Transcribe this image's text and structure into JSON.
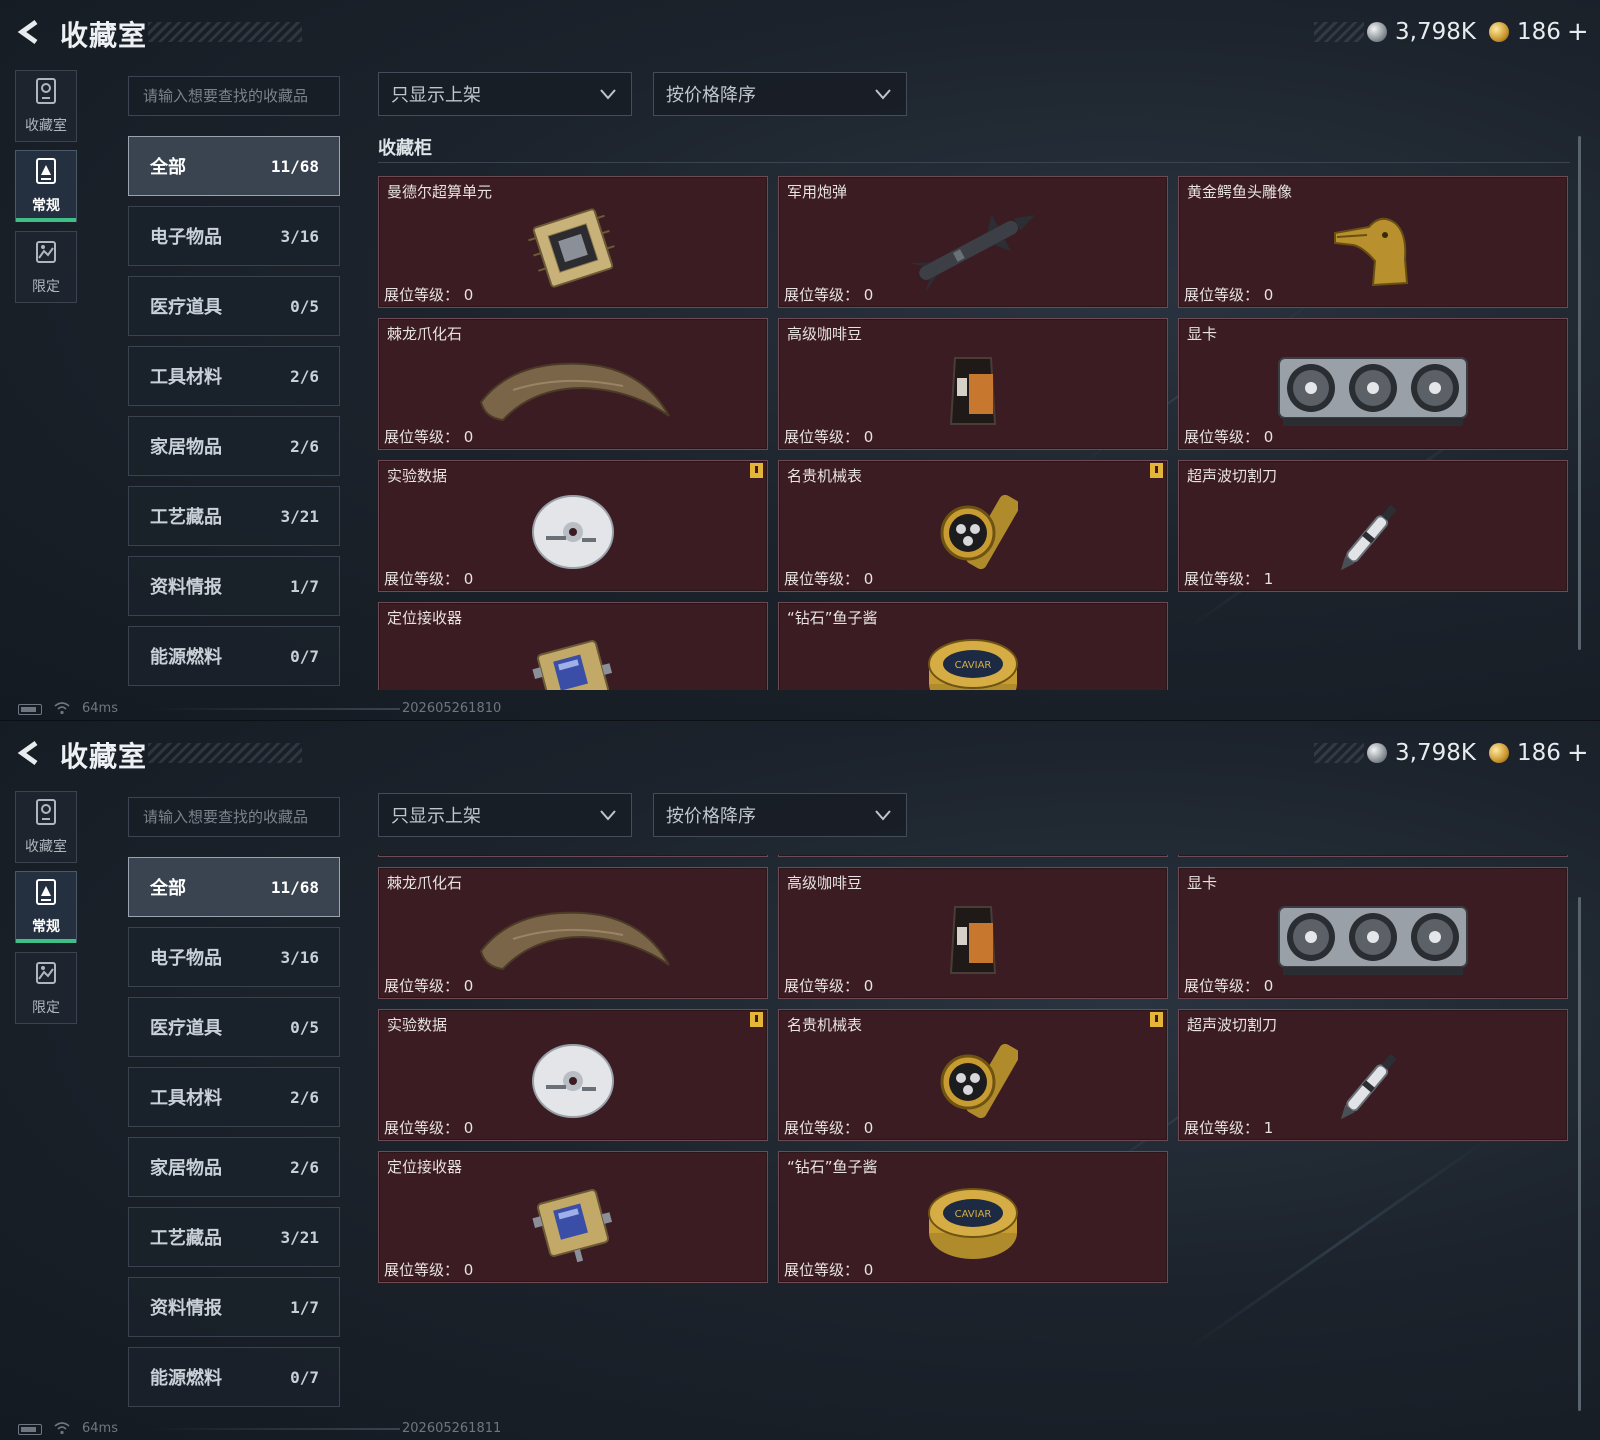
{
  "title": "收藏室",
  "currency": {
    "silver": "3,798K",
    "gold": "186",
    "add": "+"
  },
  "rail": [
    {
      "label": "收藏室",
      "icon": "trophy-icon",
      "active": false
    },
    {
      "label": "常规",
      "icon": "upload-icon",
      "active": true
    },
    {
      "label": "限定",
      "icon": "image-icon",
      "active": false
    }
  ],
  "search": {
    "placeholder": "请输入想要查找的收藏品",
    "value": ""
  },
  "filters": {
    "shelf": "只显示上架",
    "sort": "按价格降序"
  },
  "categories": [
    {
      "label": "全部",
      "count": "11/68"
    },
    {
      "label": "电子物品",
      "count": "3/16"
    },
    {
      "label": "医疗道具",
      "count": "0/5"
    },
    {
      "label": "工具材料",
      "count": "2/6"
    },
    {
      "label": "家居物品",
      "count": "2/6"
    },
    {
      "label": "工艺藏品",
      "count": "3/21"
    },
    {
      "label": "资料情报",
      "count": "1/7"
    },
    {
      "label": "能源燃料",
      "count": "0/7"
    }
  ],
  "section_title": "收藏柜",
  "level_label": "展位等级：",
  "items": [
    {
      "name": "曼德尔超算单元",
      "level": "0",
      "icon": "cpu-chip-icon",
      "alert": false
    },
    {
      "name": "军用炮弹",
      "level": "0",
      "icon": "missile-icon",
      "alert": false
    },
    {
      "name": "黄金鳄鱼头雕像",
      "level": "0",
      "icon": "gold-crocodile-statue-icon",
      "alert": false
    },
    {
      "name": "棘龙爪化石",
      "level": "0",
      "icon": "claw-fossil-icon",
      "alert": false
    },
    {
      "name": "高级咖啡豆",
      "level": "0",
      "icon": "coffee-bag-icon",
      "alert": false
    },
    {
      "name": "显卡",
      "level": "0",
      "icon": "graphics-card-icon",
      "alert": false
    },
    {
      "name": "实验数据",
      "level": "0",
      "icon": "disc-icon",
      "alert": true
    },
    {
      "name": "名贵机械表",
      "level": "0",
      "icon": "watch-icon",
      "alert": true
    },
    {
      "name": "超声波切割刀",
      "level": "1",
      "icon": "knife-icon",
      "alert": false
    },
    {
      "name": "定位接收器",
      "level": "0",
      "icon": "receiver-icon",
      "alert": false
    },
    {
      "name": "“钻石”鱼子酱",
      "level": "0",
      "icon": "caviar-tin-icon",
      "alert": false
    }
  ],
  "caviar_lid_text": "CAVIAR",
  "status": {
    "ping": "64ms"
  },
  "screens": [
    {
      "build": "202605261810"
    },
    {
      "build": "202605261811"
    }
  ]
}
